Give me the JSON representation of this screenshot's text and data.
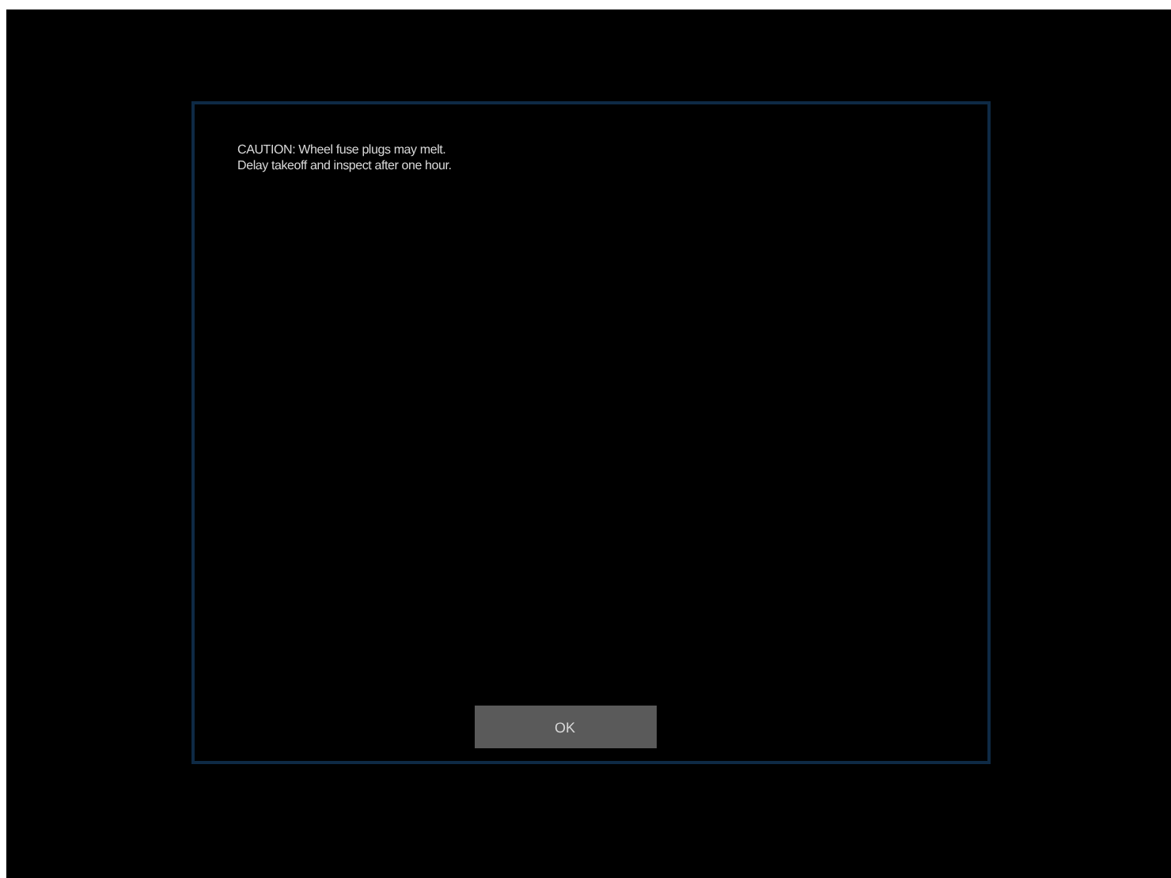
{
  "dialog": {
    "message_lines": [
      "CAUTION: Wheel fuse plugs may melt.",
      "Delay takeoff and inspect after one hour."
    ],
    "buttons": [
      "OK"
    ]
  }
}
